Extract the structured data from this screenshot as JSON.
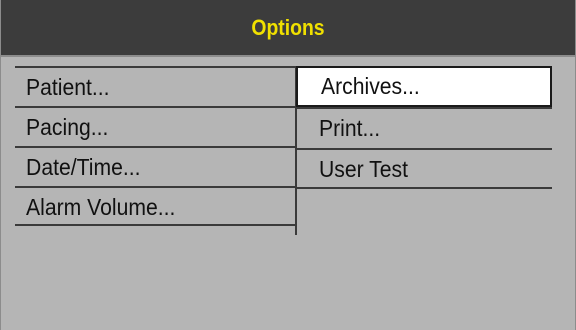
{
  "window": {
    "title": "Options",
    "title_color": "#f0e000",
    "title_bar_color": "#3c3c3c",
    "body_color": "#b5b5b5"
  },
  "menu": {
    "left_items": [
      {
        "label": "Patient..."
      },
      {
        "label": "Pacing..."
      },
      {
        "label": "Date/Time..."
      },
      {
        "label": "Alarm Volume..."
      }
    ],
    "right_items": [
      {
        "label": "Archives...",
        "selected": true
      },
      {
        "label": "Print..."
      },
      {
        "label": "User Test"
      }
    ]
  }
}
